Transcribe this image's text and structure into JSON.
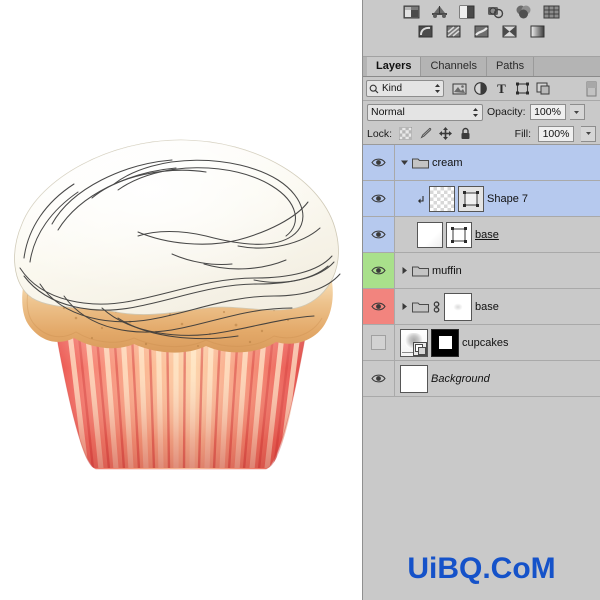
{
  "canvas": {
    "name": "cupcake-artwork",
    "description": "Cupcake illustration with white cream swirl, golden muffin top and red striped wrapper"
  },
  "adjustments": {
    "row1": [
      {
        "name": "brightness-contrast-icon",
        "label": "Brightness/Contrast"
      },
      {
        "name": "levels-icon",
        "label": "Levels"
      },
      {
        "name": "curves-icon",
        "label": "Curves"
      },
      {
        "name": "exposure-icon",
        "label": "Exposure"
      },
      {
        "name": "vibrance-icon",
        "label": "Vibrance"
      },
      {
        "name": "hue-saturation-icon",
        "label": "Hue/Saturation"
      }
    ],
    "row2": [
      {
        "name": "invert-icon",
        "label": "Invert"
      },
      {
        "name": "posterize-icon",
        "label": "Posterize"
      },
      {
        "name": "selective-color-icon",
        "label": "Selective Color"
      },
      {
        "name": "gradient-map-icon",
        "label": "Gradient Map"
      },
      {
        "name": "gradient-fill-icon",
        "label": "Gradient Fill"
      }
    ]
  },
  "tabs": [
    {
      "label": "Layers",
      "active": true
    },
    {
      "label": "Channels",
      "active": false
    },
    {
      "label": "Paths",
      "active": false
    }
  ],
  "filter": {
    "kind_label": "Kind",
    "icons": [
      {
        "name": "filter-pixel-icon",
        "label": "Pixel layers"
      },
      {
        "name": "filter-adjustment-icon",
        "label": "Adjustment layers"
      },
      {
        "name": "filter-type-icon",
        "label": "Type layers"
      },
      {
        "name": "filter-shape-icon",
        "label": "Shape layers"
      },
      {
        "name": "filter-smartobject-icon",
        "label": "Smart objects"
      }
    ],
    "toggle_name": "filter-toggle-switch"
  },
  "blend": {
    "mode": "Normal",
    "opacity_label": "Opacity:",
    "opacity_value": "100%",
    "fill_label": "Fill:",
    "fill_value": "100%"
  },
  "lock": {
    "label": "Lock:",
    "icons": [
      {
        "name": "lock-transparency-icon",
        "label": "Lock transparent pixels"
      },
      {
        "name": "lock-image-icon",
        "label": "Lock image pixels"
      },
      {
        "name": "lock-position-icon",
        "label": "Lock position"
      },
      {
        "name": "lock-all-icon",
        "label": "Lock all"
      }
    ]
  },
  "layers": [
    {
      "name": "cream",
      "visible": true,
      "selected": true,
      "eye_bg": "#b6c9ee",
      "type": "group",
      "expanded": true,
      "indent": 0,
      "editing": false,
      "italic": false
    },
    {
      "name": "Shape 7",
      "visible": true,
      "selected": true,
      "eye_bg": "#b6c9ee",
      "type": "shape",
      "clipped": true,
      "indent": 1,
      "editing": false,
      "italic": false
    },
    {
      "name": "base",
      "visible": true,
      "selected": false,
      "eye_bg": "#b6c9ee",
      "type": "shape",
      "indent": 1,
      "editing": true,
      "italic": false
    },
    {
      "name": "muffin",
      "visible": true,
      "selected": false,
      "eye_bg": "#a9e08b",
      "type": "group",
      "expanded": false,
      "indent": 0,
      "editing": false,
      "italic": false
    },
    {
      "name": "base",
      "visible": true,
      "selected": false,
      "eye_bg": "#f2847e",
      "type": "group-masked",
      "expanded": false,
      "linked": true,
      "indent": 0,
      "editing": false,
      "italic": false
    },
    {
      "name": "cupcakes",
      "visible": false,
      "selected": false,
      "eye_bg": "#c9c9c9",
      "type": "smart-object-masked",
      "indent": 0,
      "editing": false,
      "italic": false
    },
    {
      "name": "Background",
      "visible": true,
      "selected": false,
      "eye_bg": "#c9c9c9",
      "type": "background",
      "indent": 0,
      "editing": false,
      "italic": true
    }
  ],
  "watermark": {
    "text": "UiBQ.CoM",
    "color": "#1552c9"
  },
  "colors": {
    "panel_bg": "#c9c9c9",
    "selected_row": "#b6c9ee",
    "green_row": "#a9e08b",
    "red_row": "#f2847e",
    "cream": "#fbf8ee",
    "muffin": "#e8b87a",
    "wrapper_red": "#ef5a52"
  }
}
